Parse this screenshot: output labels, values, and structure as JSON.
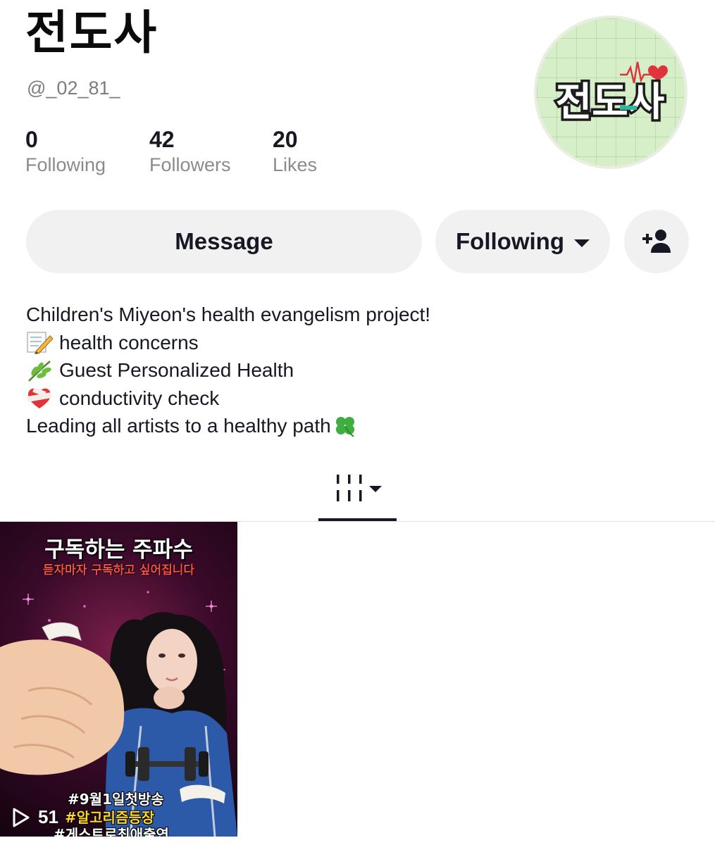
{
  "profile": {
    "display_name": "전도사",
    "handle": "@_02_81_",
    "avatar_text": "전도사"
  },
  "stats": {
    "following": {
      "value": "0",
      "label": "Following"
    },
    "followers": {
      "value": "42",
      "label": "Followers"
    },
    "likes": {
      "value": "20",
      "label": "Likes"
    }
  },
  "actions": {
    "message_label": "Message",
    "following_label": "Following",
    "add_friend_icon": "add-person-icon"
  },
  "bio": {
    "line1": "Children's Miyeon's health evangelism project!",
    "line2": {
      "emoji": "memo-pencil",
      "text": "health concerns"
    },
    "line3": {
      "emoji": "herb",
      "text": "Guest Personalized Health"
    },
    "line4": {
      "emoji": "bandaged-heart",
      "text": "conductivity check"
    },
    "line5": {
      "text": "Leading all artists to a healthy path",
      "emoji": "four-leaf-clover"
    }
  },
  "tabs": {
    "active": "videos-grid",
    "icon": "grid-lines-icon"
  },
  "videos": [
    {
      "title": "구독하는 주파수",
      "subtitle": "듣자마자 구독하고 싶어집니다",
      "tags": [
        "#9월1일첫방송",
        "#알고리즘등장",
        "#게스트로최애출연"
      ],
      "views": "51"
    }
  ],
  "colors": {
    "text": "#161823",
    "muted": "#8a8b91",
    "button_bg": "#f1f1f2",
    "avatar_bg": "#d6efc8"
  }
}
